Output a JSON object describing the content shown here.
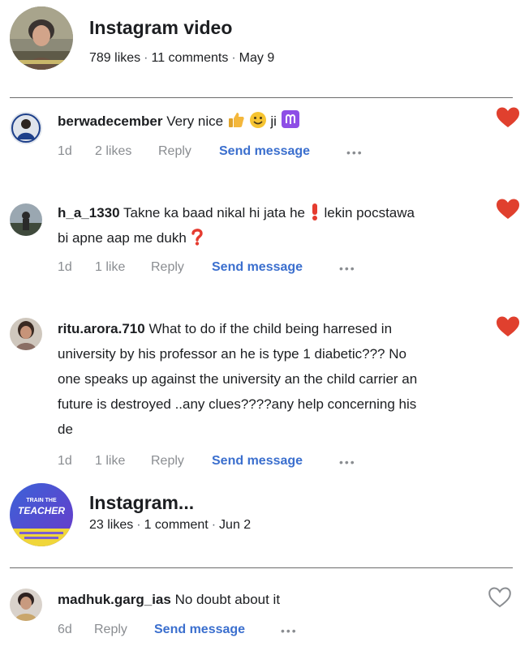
{
  "post1": {
    "title": "Instagram video",
    "likes": "789 likes",
    "comments": "11 comments",
    "date": "May 9"
  },
  "comments1": [
    {
      "username": "berwadecember",
      "text_a": "Very nice",
      "text_b": "ji",
      "time": "1d",
      "likes": "2 likes",
      "reply": "Reply",
      "send": "Send message",
      "liked": true
    },
    {
      "username": "h_a_1330",
      "text_a": "Takne ka baad nikal hi jata he",
      "text_b": "lekin pocstawa",
      "text_c": "bi apne aap me dukh",
      "time": "1d",
      "likes": "1 like",
      "reply": "Reply",
      "send": "Send message",
      "liked": true
    },
    {
      "username": "ritu.arora.710",
      "text_a": "What to do if the child being harresed in",
      "line2": "university by his professor an he is type 1 diabetic??? No",
      "line3": "one speaks up against the university an the child carrier an",
      "line4": "future is destroyed ..any clues????any help concerning his",
      "line5": "de",
      "time": "1d",
      "likes": "1 like",
      "reply": "Reply",
      "send": "Send message",
      "liked": true
    }
  ],
  "post2": {
    "title": "Instagram...",
    "likes": "23 likes",
    "comments": "1 comment",
    "date": "Jun 2",
    "thumb_text_1": "TRAIN THE",
    "thumb_text_2": "TEACHER"
  },
  "comments2": [
    {
      "username": "madhuk.garg_ias",
      "text_a": "No doubt about it",
      "time": "6d",
      "reply": "Reply",
      "send": "Send message",
      "liked": false
    }
  ],
  "icons": {
    "heart_filled_color": "#e0402e",
    "heart_outline_color": "#8a8d91",
    "link_color": "#3b6fce"
  }
}
